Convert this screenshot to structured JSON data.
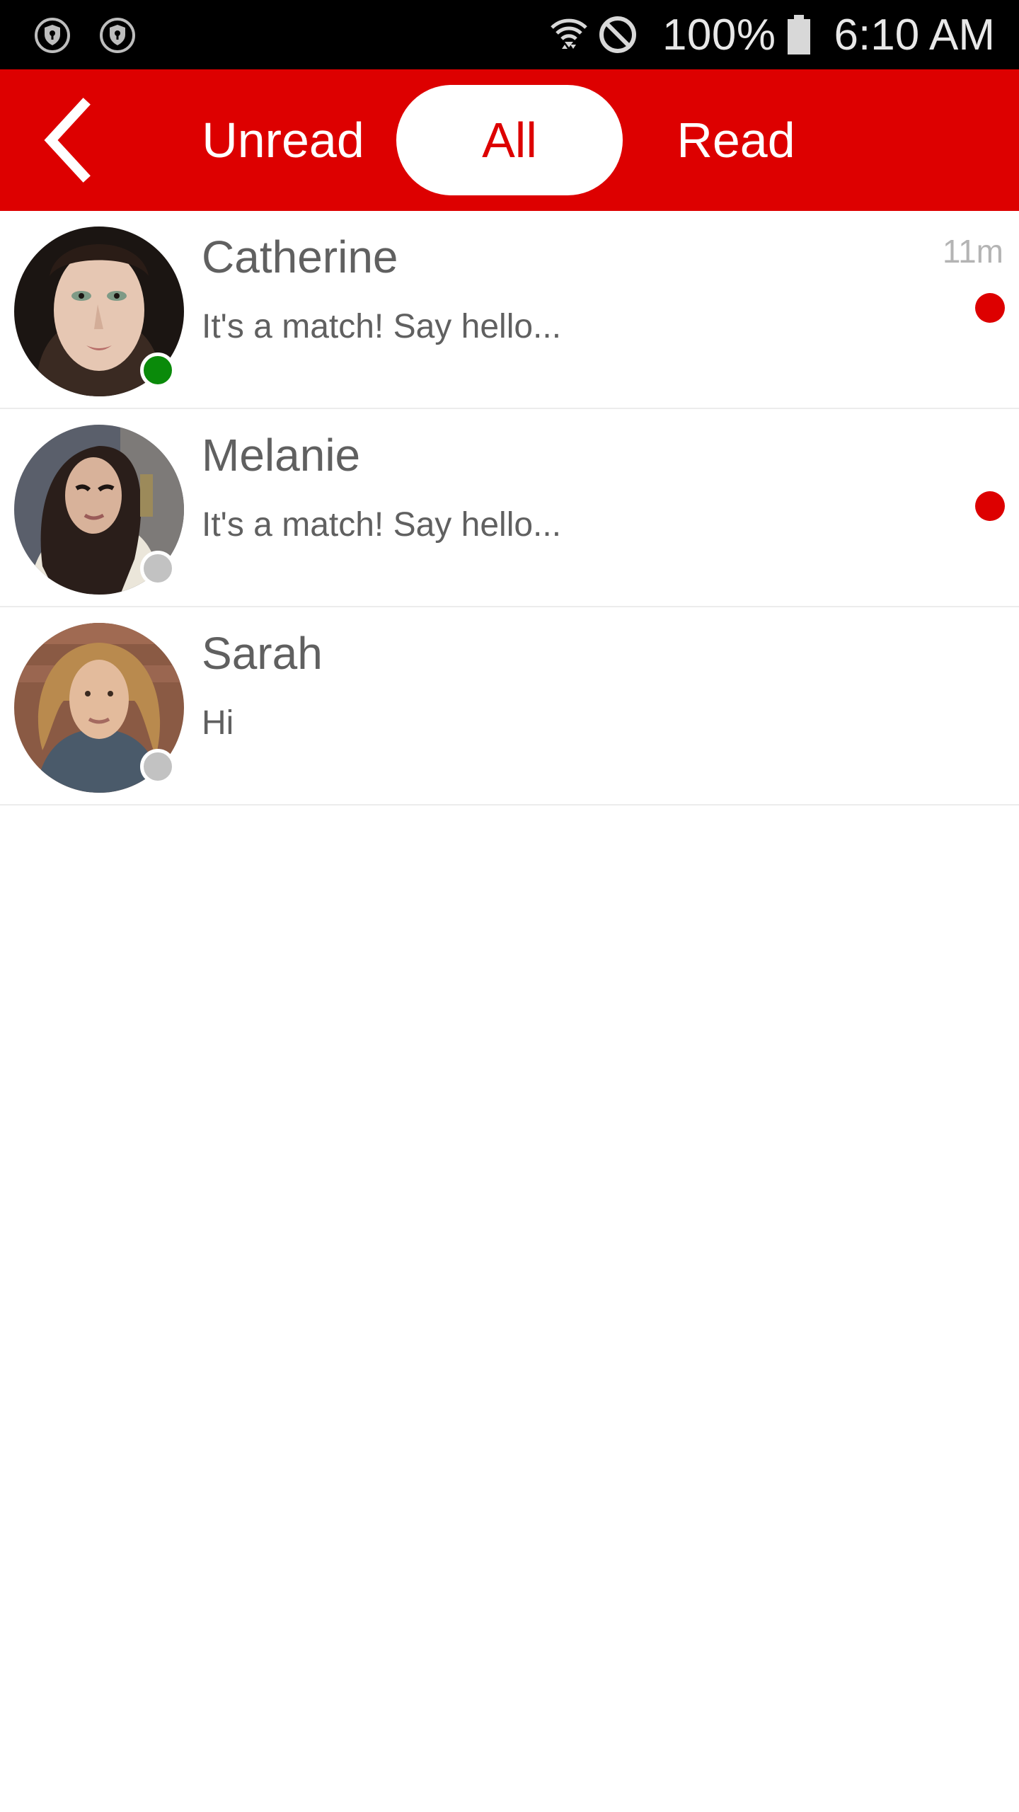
{
  "status_bar": {
    "battery_percent": "100%",
    "time": "6:10 AM"
  },
  "header": {
    "back_icon": "chevron-left-icon",
    "tabs": [
      {
        "label": "Unread",
        "active": false
      },
      {
        "label": "All",
        "active": true
      },
      {
        "label": "Read",
        "active": false
      }
    ]
  },
  "colors": {
    "brand_red": "#dd0000",
    "online_green": "#0a8a0a",
    "offline_gray": "#c2c2c2",
    "unread_red": "#dd0000",
    "text_gray": "#606060",
    "time_gray": "#b4b4b4"
  },
  "conversations": [
    {
      "name": "Catherine",
      "preview": "It's a match! Say hello...",
      "time": "11m",
      "online": true,
      "unread": true
    },
    {
      "name": "Melanie",
      "preview": "It's a match! Say hello...",
      "time": "",
      "online": false,
      "unread": true
    },
    {
      "name": "Sarah",
      "preview": "Hi",
      "time": "",
      "online": false,
      "unread": false
    }
  ]
}
